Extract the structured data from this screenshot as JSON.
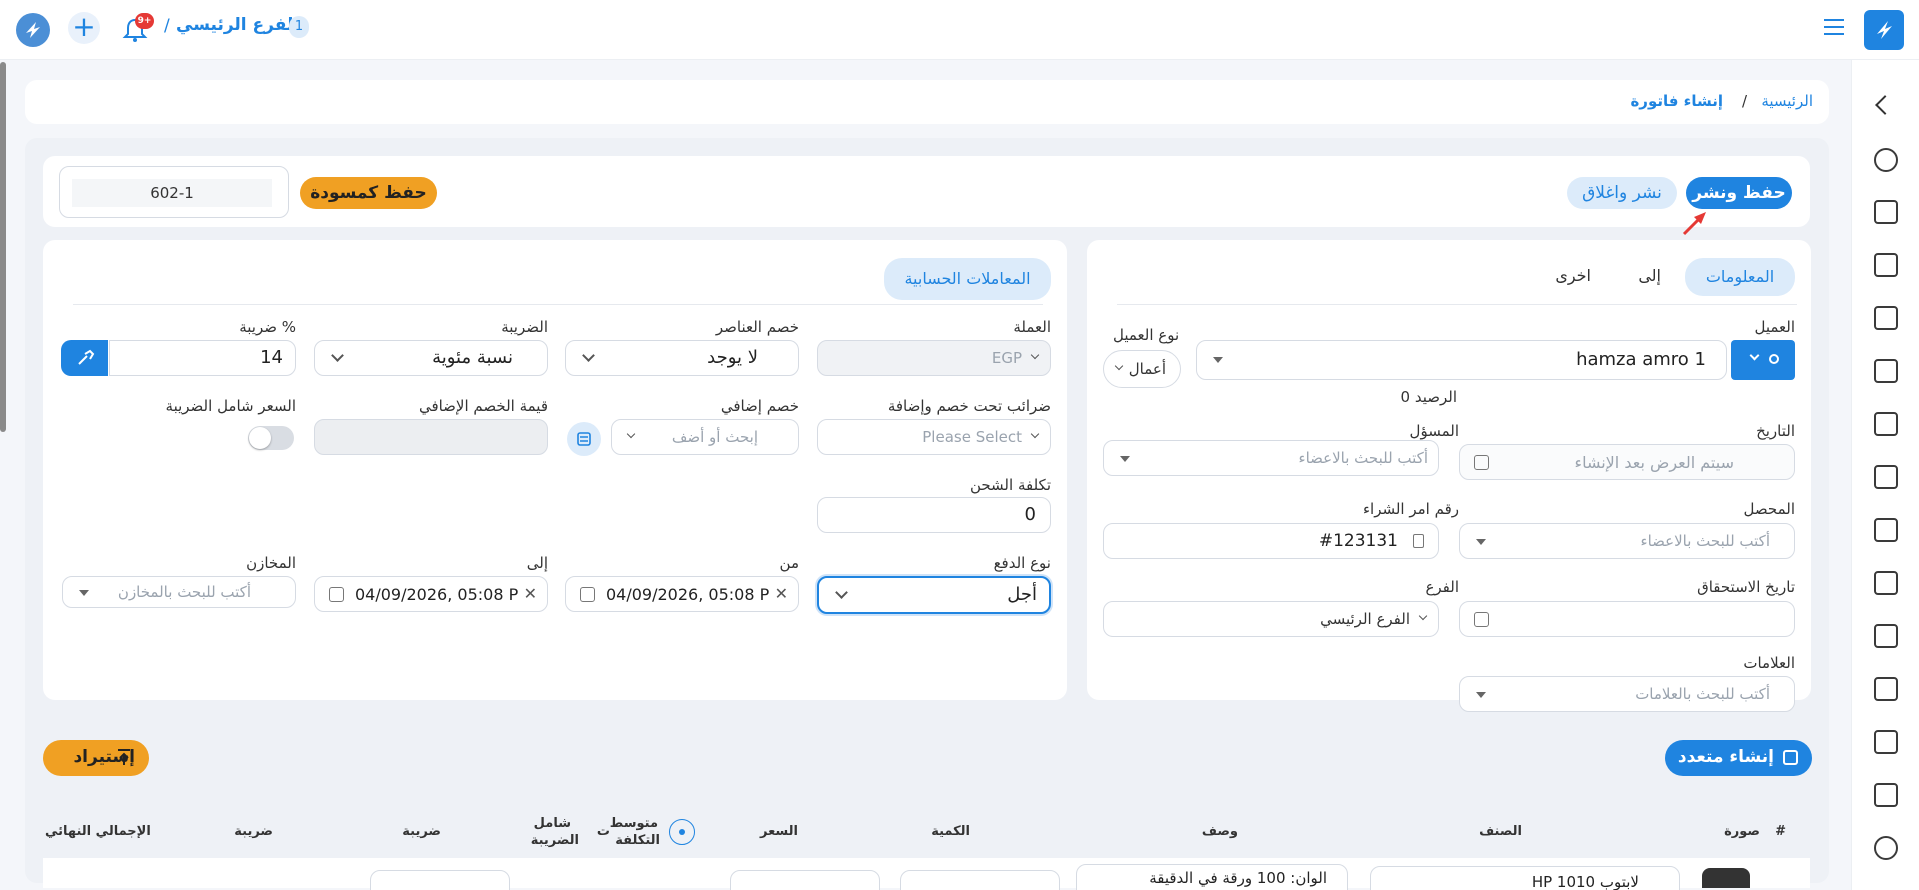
{
  "topbar": {
    "branch_badge": "1",
    "branch_name": "الفرع الرئيسي",
    "separator": "/",
    "notification_count": "9+"
  },
  "breadcrumb": {
    "home": "الرئيسية",
    "sep": "/",
    "current": "إنشاء فاتورة"
  },
  "actions": {
    "save_publish": "حفظ ونشر",
    "publish_close": "نشر واغلاق",
    "save_draft": "حفظ كمسودة",
    "invoice_number": "602-1"
  },
  "tabs": {
    "info": "المعلومات",
    "to": "إلى",
    "other": "اخرى",
    "accounting": "المعاملات الحسابية"
  },
  "form": {
    "customer_label": "العميل",
    "customer_value": "hamza amro 1",
    "customer_type_label": "نوع العميل",
    "customer_type_value": "أعمال",
    "balance": "الرصيد 0",
    "date_label": "التاريخ",
    "date_placeholder": "سيتم العرض بعد الإنشاء",
    "responsible_label": "المسؤل",
    "members_placeholder": "أكتب للبحث بالاعضاء",
    "collector_label": "المحصل",
    "po_label": "رقم امر الشراء",
    "po_value": "#123131",
    "due_label": "تاريخ الاستحقاق",
    "branch_label": "الفرع",
    "branch_value": "الفرع الرئيسي",
    "tags_label": "العلامات",
    "tags_placeholder": "أكتب للبحث بالعلامات"
  },
  "accounting": {
    "currency_label": "العملة",
    "currency_value": "EGP",
    "item_discount_label": "خصم العناصر",
    "item_discount_value": "لا يوجد",
    "tax_label": "الضريبة",
    "tax_value": "نسبة مئوية",
    "tax_pct_label": "ضريبة %",
    "tax_pct_value": "14",
    "taxes_under_label": "ضرائب تحت خصم وإضافة",
    "taxes_under_placeholder": "Please Select",
    "extra_discount_label": "خصم إضافي",
    "extra_discount_placeholder": "إبحث أو أضف",
    "extra_discount_value_label": "قيمة الخصم الإضافي",
    "price_incl_label": "السعر شامل الضريبة",
    "price_incl_on": false,
    "shipping_label": "تكلفة الشحن",
    "shipping_value": "0",
    "payment_type_label": "نوع الدفع",
    "payment_type_value": "أجل",
    "from_label": "من",
    "from_value": "04/09/2026, 05:08 P",
    "to_label": "إلى",
    "to_value": "04/09/2026, 05:08 P",
    "warehouses_label": "المخازن",
    "warehouses_placeholder": "أكتب للبحث بالمخازن"
  },
  "items": {
    "create_multiple": "إنشاء متعدد",
    "import": "إستيراد",
    "headers": {
      "num": "#",
      "image": "صورة",
      "item": "الصنف",
      "description": "وصف",
      "quantity": "الكمية",
      "price": "السعر",
      "avg_cost_1": "متوسط",
      "avg_cost_2": "التكلفة",
      "t": "ت",
      "incl_tax_1": "شامل",
      "incl_tax_2": "الضريبة",
      "tax1": "ضريبة",
      "tax2": "ضريبة",
      "total": "الإجمالي النهائي"
    },
    "row_item": "HP 1010 لابتوب",
    "row_description": "الوان: 100 ورقة في الدقيقة"
  },
  "colors": {
    "primary": "#1f84e0",
    "orange": "#f0a023",
    "light_blue": "#dcebfa"
  }
}
